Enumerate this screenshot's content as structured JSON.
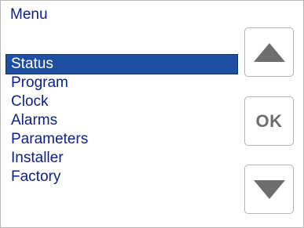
{
  "menu": {
    "title": "Menu",
    "items": [
      {
        "label": "Status",
        "selected": true
      },
      {
        "label": "Program",
        "selected": false
      },
      {
        "label": "Clock",
        "selected": false
      },
      {
        "label": "Alarms",
        "selected": false
      },
      {
        "label": "Parameters",
        "selected": false
      },
      {
        "label": "Installer",
        "selected": false
      },
      {
        "label": "Factory",
        "selected": false
      }
    ]
  },
  "buttons": {
    "up_icon": "up-arrow-icon",
    "ok_label": "OK",
    "down_icon": "down-arrow-icon"
  },
  "colors": {
    "text": "#0a1f8a",
    "selection": "#1f4fa3",
    "selection_text": "#ffffff",
    "button_glyph": "#6e6e6e",
    "button_border": "#b5b5b5"
  }
}
